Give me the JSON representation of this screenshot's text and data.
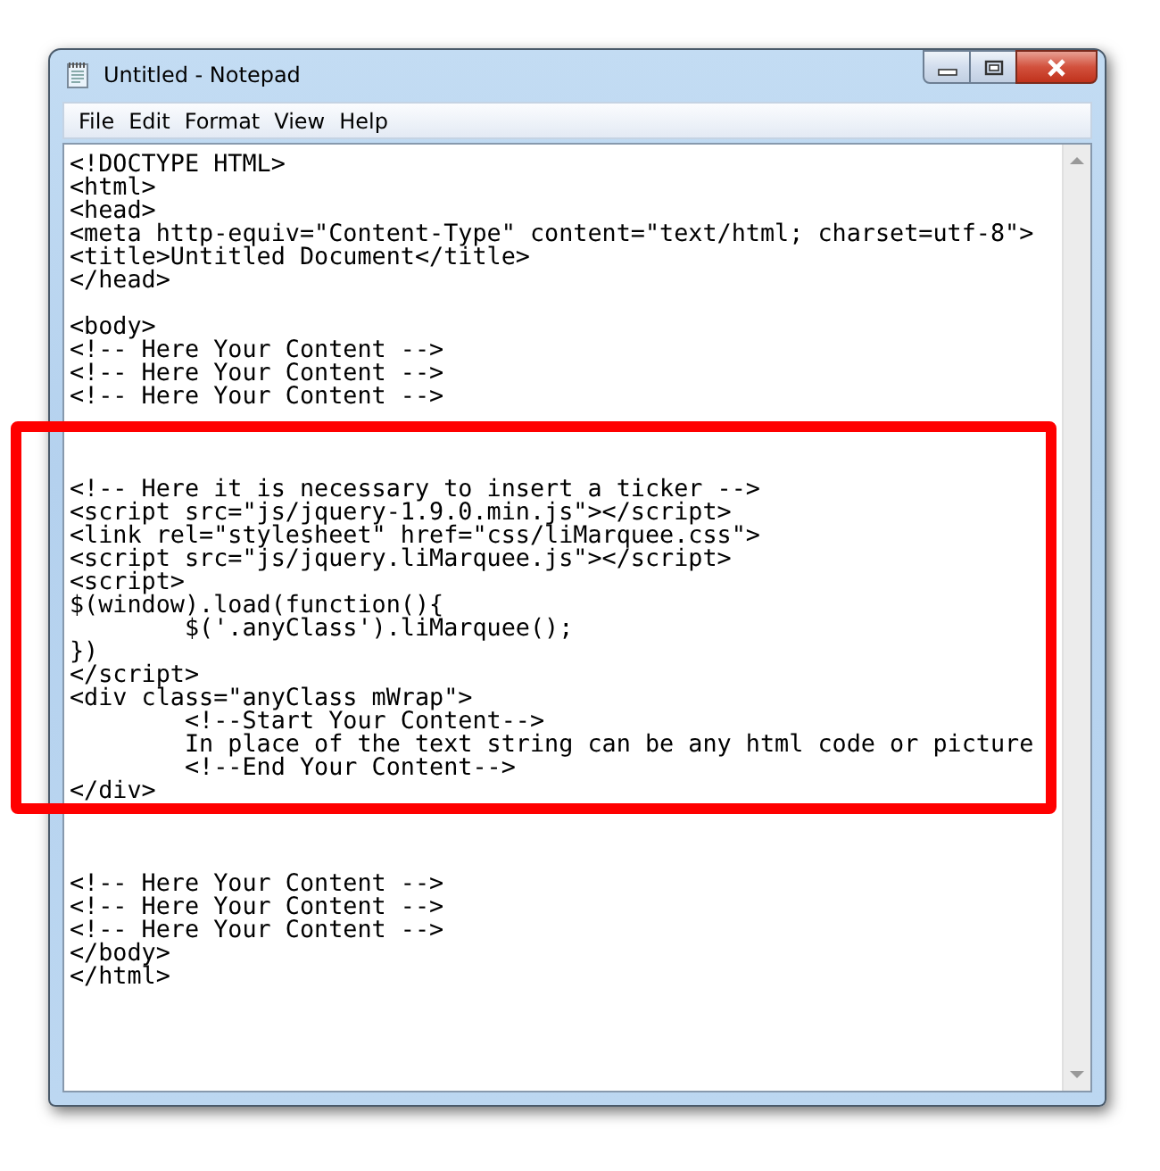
{
  "window": {
    "title": "Untitled - Notepad"
  },
  "menu": [
    "File",
    "Edit",
    "Format",
    "View",
    "Help"
  ],
  "groups": [
    {
      "highlighted": false,
      "text": "<!DOCTYPE HTML>\n<html>\n<head>\n<meta http-equiv=\"Content-Type\" content=\"text/html; charset=utf-8\">\n<title>Untitled Document</title>\n</head>\n\n<body>\n<!-- Here Your Content -->\n<!-- Here Your Content -->\n<!-- Here Your Content -->\n"
    },
    {
      "highlighted": true,
      "text": "\n\n<!-- Here it is necessary to insert a ticker -->\n<script src=\"js/jquery-1.9.0.min.js\"></script>\n<link rel=\"stylesheet\" href=\"css/liMarquee.css\">\n<script src=\"js/jquery.liMarquee.js\"></script>\n<script>\n$(window).load(function(){\n\t$('.anyClass').liMarquee();\n})\n</script>\n<div class=\"anyClass mWrap\">\n\t<!--Start Your Content-->\n\tIn place of the text string can be any html code or picture\n\t<!--End Your Content-->\n</div>"
    },
    {
      "highlighted": false,
      "text": "\n\n\n<!-- Here Your Content -->\n<!-- Here Your Content -->\n<!-- Here Your Content -->\n</body>\n</html>"
    }
  ]
}
